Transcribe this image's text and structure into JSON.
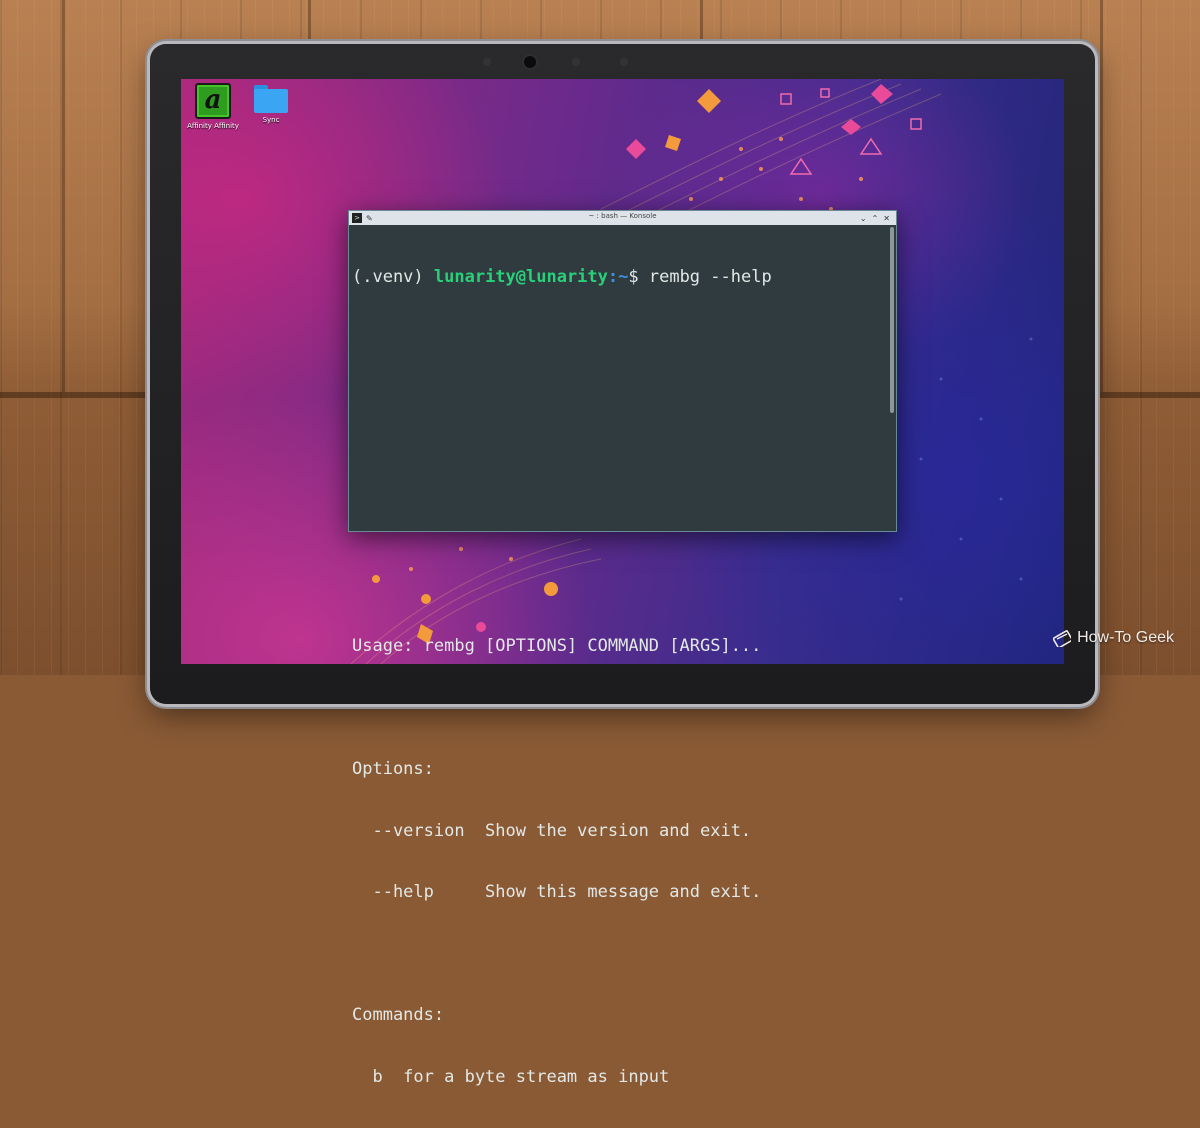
{
  "desktop": {
    "icons": [
      {
        "label": "Affinity Affinity",
        "icon": "affinity-app-icon"
      },
      {
        "label": "Sync",
        "icon": "folder-icon"
      }
    ]
  },
  "konsole": {
    "title": "~ : bash — Konsole",
    "prompt": {
      "venv": "(.venv) ",
      "user_host": "lunarity@lunarity",
      "path": ":~",
      "symbol": "$",
      "command": " rembg --help"
    },
    "output": [
      "",
      "",
      "",
      "",
      "",
      "Usage: rembg [OPTIONS] COMMAND [ARGS]...",
      "",
      "Options:",
      "  --version  Show the version and exit.",
      "  --help     Show this message and exit.",
      "",
      "Commands:",
      "  b  for a byte stream as input"
    ]
  },
  "watermark": "How-To Geek",
  "colors": {
    "prompt_user": "#29d07a",
    "prompt_path": "#3d8fe0",
    "terminal_bg": "#2f3b3f",
    "terminal_fg": "#e2e8e6"
  }
}
